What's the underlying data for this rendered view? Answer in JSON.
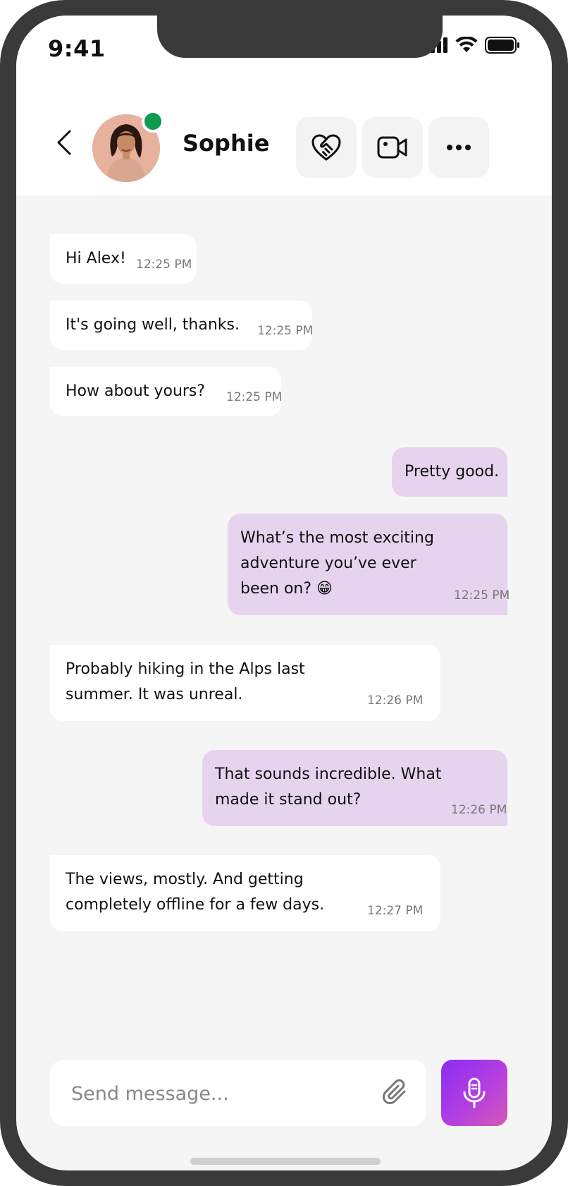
{
  "status_bar": {
    "time": "9:41"
  },
  "header": {
    "contact_name": "Sophie",
    "online_color": "#0f9b4e"
  },
  "messages": [
    {
      "dir": "in",
      "text": "Hi Alex!",
      "time": "12:25 PM"
    },
    {
      "dir": "in",
      "text": "It's going well, thanks.",
      "time": "12:25 PM"
    },
    {
      "dir": "in",
      "text": "How about yours?",
      "time": "12:25 PM"
    },
    {
      "dir": "out",
      "text": "Pretty good.",
      "time": ""
    },
    {
      "dir": "out",
      "text": "What’s the most exciting adventure you’ve ever been on? 😁",
      "time": "12:25 PM"
    },
    {
      "dir": "in",
      "text": "Probably hiking in the Alps last summer. It was unreal.",
      "time": "12:26 PM"
    },
    {
      "dir": "out",
      "text": "That sounds incredible. What made it stand out?",
      "time": "12:26 PM"
    },
    {
      "dir": "in",
      "text": "The views, mostly. And getting completely offline for a few days.",
      "time": "12:27 PM"
    }
  ],
  "composer": {
    "placeholder": "Send message..."
  },
  "icons": {
    "back": "chevron-left-icon",
    "heart": "heart-handshake-icon",
    "video": "video-camera-icon",
    "more": "more-horizontal-icon",
    "attach": "paperclip-icon",
    "mic": "microphone-icon"
  },
  "colors": {
    "incoming_bubble": "#ffffff",
    "outgoing_bubble": "#e6d4ef",
    "accent": "#8a2cf3"
  }
}
